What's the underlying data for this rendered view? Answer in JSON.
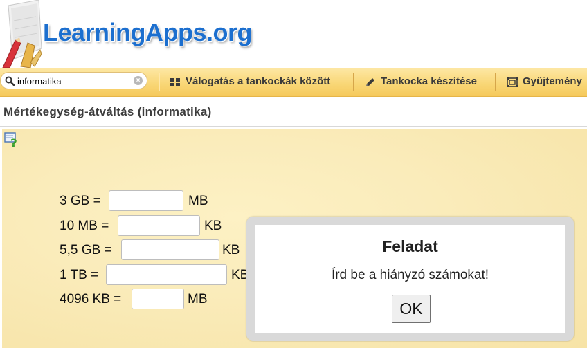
{
  "header": {
    "logo_text": "LearningApps.org"
  },
  "navbar": {
    "search": {
      "value": "informatika",
      "placeholder": ""
    },
    "items": [
      {
        "label": "Válogatás a tankockák között",
        "icon": "grid-icon"
      },
      {
        "label": "Tankocka készítése",
        "icon": "pencil-icon"
      },
      {
        "label": "Gyűjtemény",
        "icon": "collection-icon"
      }
    ]
  },
  "page": {
    "title": "Mértékegység-átváltás (informatika)"
  },
  "exercise": {
    "rows": [
      {
        "lhs": "3 GB =",
        "value": "",
        "unit": "MB"
      },
      {
        "lhs": "10 MB =",
        "value": "",
        "unit": "KB"
      },
      {
        "lhs": "5,5 GB =",
        "value": "",
        "unit": "KB"
      },
      {
        "lhs": "1 TB =",
        "value": "",
        "unit": "KB"
      },
      {
        "lhs": "4096 KB =",
        "value": "",
        "unit": "MB"
      }
    ]
  },
  "dialog": {
    "title": "Feladat",
    "message": "Írd be a hiányzó számokat!",
    "ok_label": "OK"
  },
  "colors": {
    "logo_blue": "#1c6fcf",
    "navbar_yellow": "#f9d777",
    "app_background": "#faecbb",
    "dialog_frame": "#d9d9d9"
  }
}
